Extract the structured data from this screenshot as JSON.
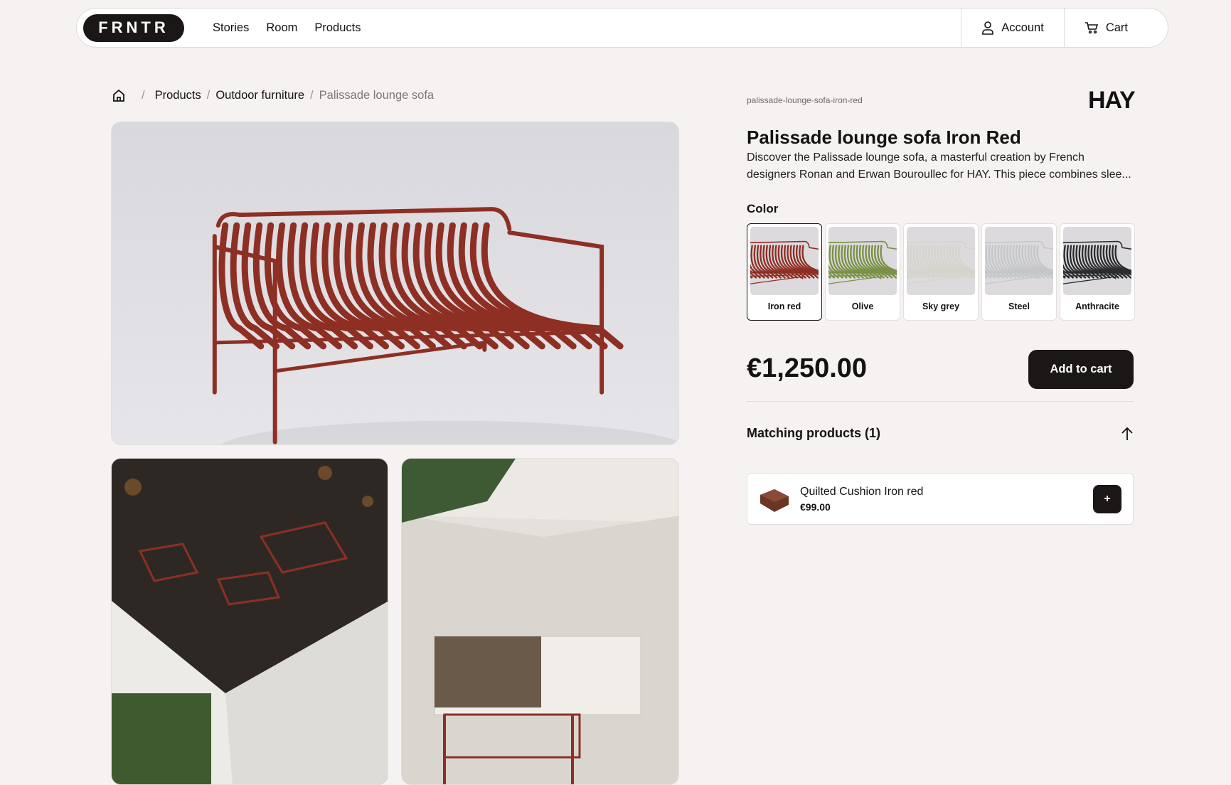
{
  "nav": {
    "logo": "FRNTR",
    "links": [
      "Stories",
      "Room",
      "Products"
    ],
    "account": "Account",
    "cart": "Cart"
  },
  "breadcrumb": {
    "items": [
      "Products",
      "Outdoor furniture"
    ],
    "current": "Palissade lounge sofa",
    "separator": "/"
  },
  "product": {
    "slug": "palissade-lounge-sofa-iron-red",
    "brand": "HAY",
    "title": "Palissade lounge sofa Iron Red",
    "description": "Discover the Palissade lounge sofa, a masterful creation by French designers Ronan and Erwan Bouroullec for HAY. This piece combines slee...",
    "color_label": "Color",
    "colors": [
      {
        "label": "Iron red",
        "hex": "#8e2f24",
        "selected": true
      },
      {
        "label": "Olive",
        "hex": "#7a9146",
        "selected": false
      },
      {
        "label": "Sky grey",
        "hex": "#d4d4cc",
        "selected": false
      },
      {
        "label": "Steel",
        "hex": "#c4c6c8",
        "selected": false
      },
      {
        "label": "Anthracite",
        "hex": "#2b2c2e",
        "selected": false
      }
    ],
    "price": "€1,250.00",
    "add_to_cart": "Add to cart"
  },
  "matching": {
    "title": "Matching products (1)",
    "items": [
      {
        "name": "Quilted Cushion Iron red",
        "price": "€99.00"
      }
    ]
  },
  "icons": {
    "home": "home-icon",
    "account": "user-icon",
    "cart": "cart-icon",
    "collapse": "arrow-up-icon",
    "add": "plus-icon"
  }
}
